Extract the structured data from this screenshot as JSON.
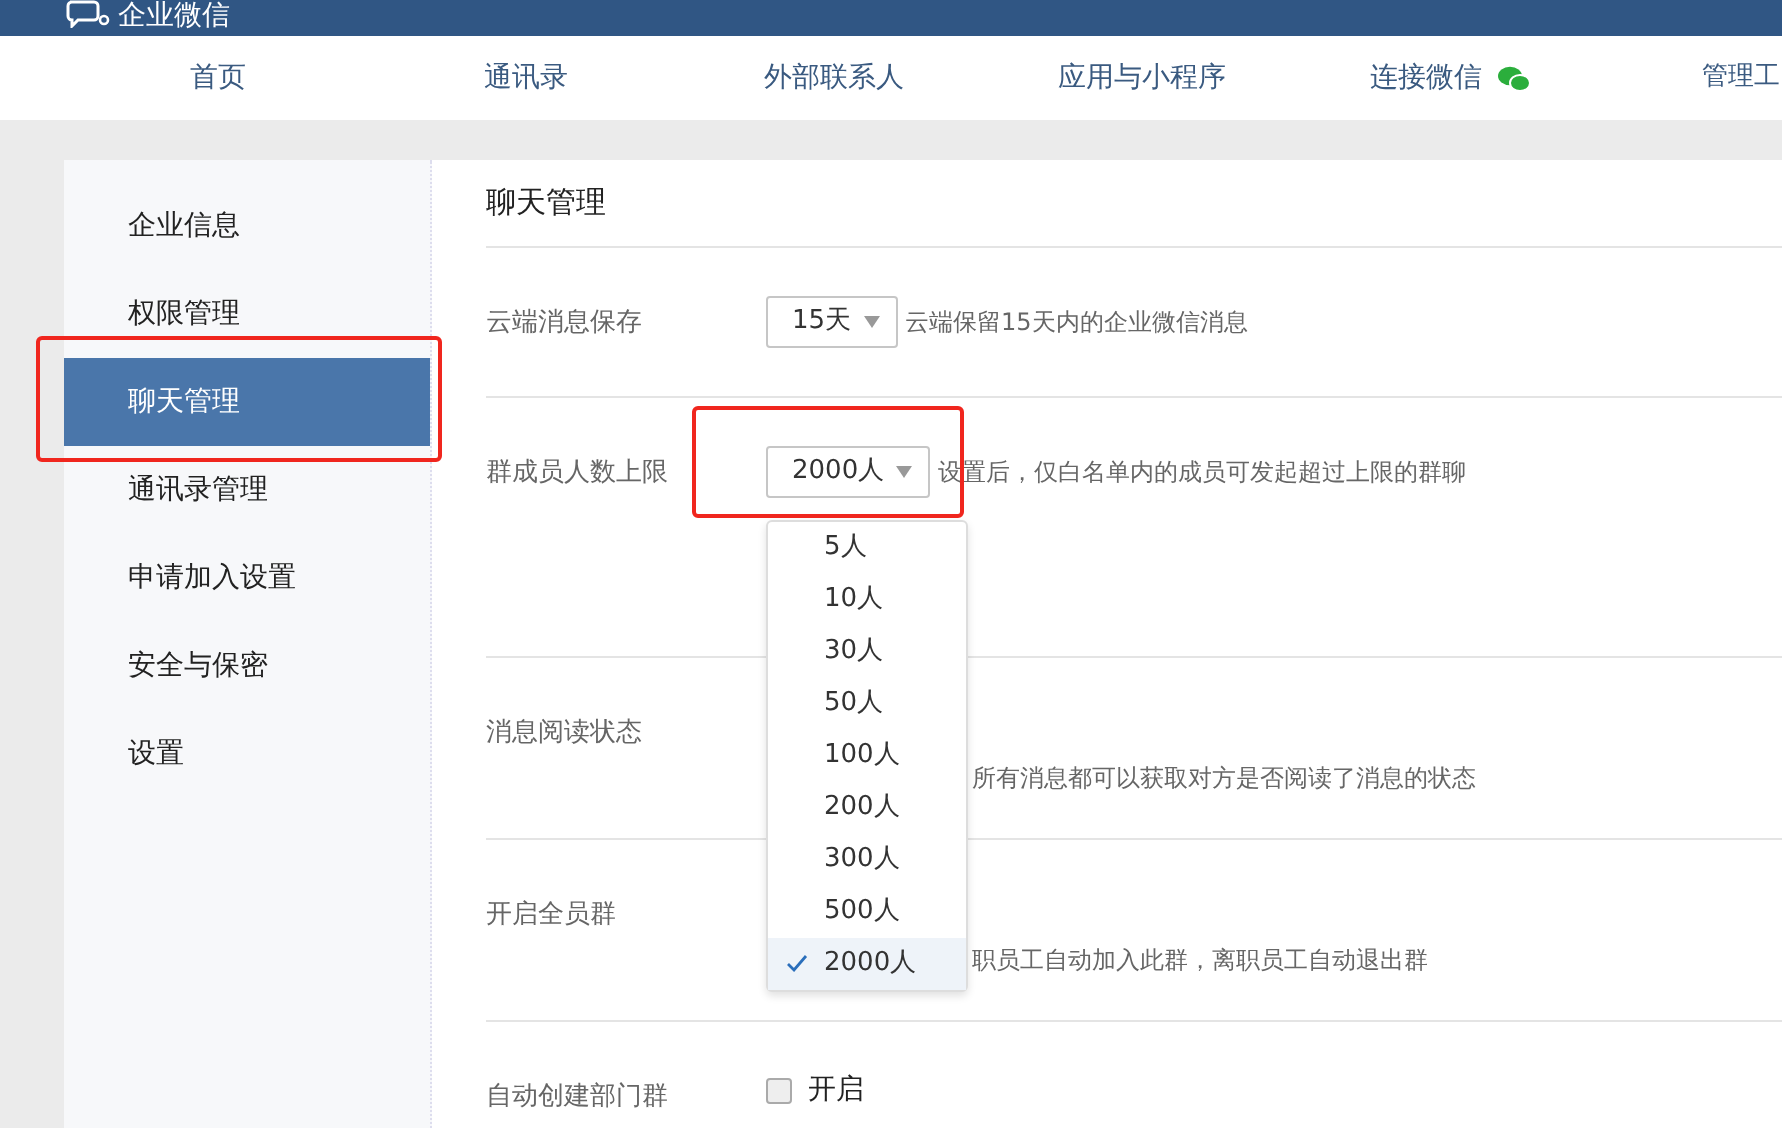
{
  "header": {
    "brand": "企业微信"
  },
  "nav": [
    {
      "label": "首页",
      "kind": "text"
    },
    {
      "label": "通讯录",
      "kind": "text"
    },
    {
      "label": "外部联系人",
      "kind": "text"
    },
    {
      "label": "应用与小程序",
      "kind": "text"
    },
    {
      "label": "连接微信",
      "kind": "wechat"
    },
    {
      "label": "管理工",
      "kind": "text"
    }
  ],
  "sidebar": {
    "items": [
      {
        "label": "企业信息",
        "selected": false
      },
      {
        "label": "权限管理",
        "selected": false
      },
      {
        "label": "聊天管理",
        "selected": true
      },
      {
        "label": "通讯录管理",
        "selected": false
      },
      {
        "label": "申请加入设置",
        "selected": false
      },
      {
        "label": "安全与保密",
        "selected": false
      },
      {
        "label": "设置",
        "selected": false
      }
    ]
  },
  "content": {
    "title": "聊天管理",
    "rows": [
      {
        "label": "云端消息保存",
        "kind": "select",
        "value": "15天",
        "hint": "云端保留15天内的企业微信消息"
      },
      {
        "label": "群成员人数上限",
        "kind": "select",
        "value": "2000人",
        "hint": "设置后，仅白名单内的成员可发起超过上限的群聊"
      },
      {
        "label": "消息阅读状态",
        "kind": "covered",
        "hint": "所有消息都可以获取对方是否阅读了消息的状态"
      },
      {
        "label": "开启全员群",
        "kind": "covered",
        "hint": "职员工自动加入此群，离职员工自动退出群"
      },
      {
        "label": "自动创建部门群",
        "kind": "checkbox",
        "checked": false,
        "option": "开启"
      }
    ]
  },
  "dropdown": {
    "options": [
      {
        "label": "5人",
        "selected": false
      },
      {
        "label": "10人",
        "selected": false
      },
      {
        "label": "30人",
        "selected": false
      },
      {
        "label": "50人",
        "selected": false
      },
      {
        "label": "100人",
        "selected": false
      },
      {
        "label": "200人",
        "selected": false
      },
      {
        "label": "300人",
        "selected": false
      },
      {
        "label": "500人",
        "selected": false
      },
      {
        "label": "2000人",
        "selected": true
      }
    ]
  }
}
